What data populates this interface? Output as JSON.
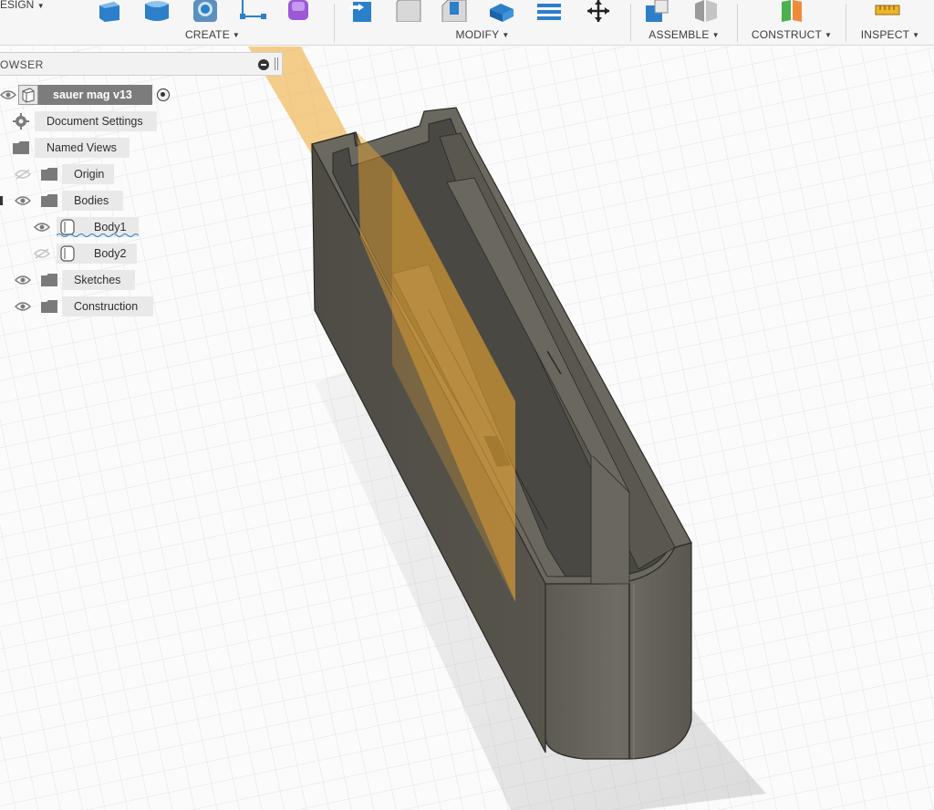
{
  "toolbar": {
    "workspace_label": "ESIGN",
    "groups": [
      {
        "label": "CREATE"
      },
      {
        "label": "MODIFY"
      },
      {
        "label": "ASSEMBLE"
      },
      {
        "label": "CONSTRUCT"
      },
      {
        "label": "INSPECT"
      }
    ]
  },
  "browser": {
    "title": "OWSER",
    "root": {
      "label": "sauer mag v13"
    },
    "items": [
      {
        "label": "Document Settings"
      },
      {
        "label": "Named Views"
      },
      {
        "label": "Origin"
      },
      {
        "label": "Bodies"
      },
      {
        "label": "Body1"
      },
      {
        "label": "Body2"
      },
      {
        "label": "Sketches"
      },
      {
        "label": "Construction"
      }
    ]
  },
  "colors": {
    "body": "#5f5c52",
    "construction_plane": "#f0a830",
    "grid": "#d6d6d6"
  }
}
